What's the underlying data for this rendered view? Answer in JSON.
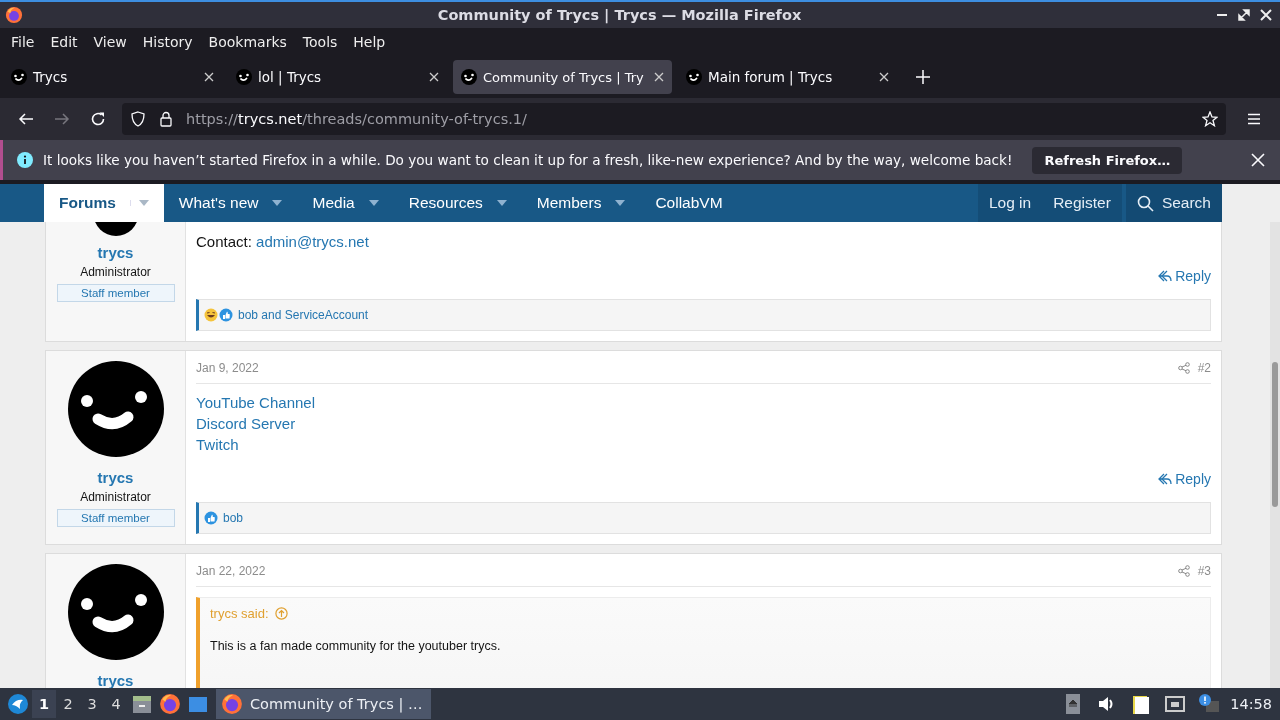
{
  "window": {
    "title": "Community of Trycs | Trycs — Mozilla Firefox"
  },
  "menu": [
    "File",
    "Edit",
    "View",
    "History",
    "Bookmarks",
    "Tools",
    "Help"
  ],
  "tabs": [
    {
      "title": "Trycs",
      "selected": false
    },
    {
      "title": "lol | Trycs",
      "selected": false
    },
    {
      "title": "Community of Trycs | Try",
      "selected": true
    },
    {
      "title": "Main forum | Trycs",
      "selected": false
    }
  ],
  "address": {
    "scheme": "https://",
    "host": "trycs.net",
    "path": "/threads/community-of-trycs.1/"
  },
  "notification": {
    "message": "It looks like you haven’t started Firefox in a while. Do you want to clean it up for a fresh, like-new experience? And by the way, welcome back!",
    "button": "Refresh Firefox…"
  },
  "forum_nav": {
    "items": [
      {
        "label": "Forums",
        "selected": true,
        "has_menu": true
      },
      {
        "label": "What's new",
        "selected": false,
        "has_menu": true
      },
      {
        "label": "Media",
        "selected": false,
        "has_menu": true
      },
      {
        "label": "Resources",
        "selected": false,
        "has_menu": true
      },
      {
        "label": "Members",
        "selected": false,
        "has_menu": true
      },
      {
        "label": "CollabVM",
        "selected": false,
        "has_menu": false
      }
    ],
    "user_links": [
      "Log in",
      "Register"
    ],
    "search": "Search"
  },
  "posts": [
    {
      "author": "trycs",
      "role": "Administrator",
      "badge": "Staff member",
      "avatar_cut": true,
      "body": [
        {
          "kind": "contact",
          "label": "Contact:",
          "link": "admin@trycs.net"
        }
      ],
      "reply": "Reply",
      "reactions": {
        "icons": [
          {
            "kind": "laugh"
          },
          {
            "kind": "like"
          }
        ],
        "names": "bob and ServiceAccount"
      }
    },
    {
      "author": "trycs",
      "role": "Administrator",
      "badge": "Staff member",
      "avatar_cut": false,
      "date": "Jan 9, 2022",
      "number": "#2",
      "body": [
        {
          "kind": "link",
          "text": "YouTube Channel"
        },
        {
          "kind": "link",
          "text": "Discord Server"
        },
        {
          "kind": "link",
          "text": "Twitch"
        }
      ],
      "reply": "Reply",
      "reactions": {
        "icons": [
          {
            "kind": "like"
          }
        ],
        "names": "bob"
      }
    },
    {
      "author": "trycs",
      "avatar_cut": false,
      "date": "Jan 22, 2022",
      "number": "#3",
      "body": [
        {
          "kind": "quote",
          "author": "trycs said:",
          "text": "This is a fan made community for the youtuber trycs."
        }
      ]
    }
  ],
  "taskbar": {
    "workspaces": [
      {
        "label": "1",
        "selected": true
      },
      {
        "label": "2",
        "selected": false
      },
      {
        "label": "3",
        "selected": false
      },
      {
        "label": "4",
        "selected": false
      }
    ],
    "window_button": "Community of Trycs | …",
    "clock": "14:58"
  }
}
